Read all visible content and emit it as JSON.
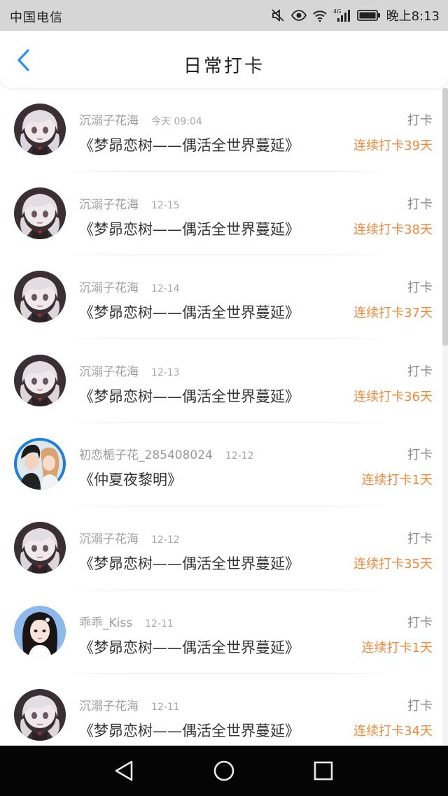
{
  "status_bar": {
    "carrier": "中国电信",
    "time": "晚上8:13",
    "network": "4G"
  },
  "header": {
    "title": "日常打卡",
    "back_icon": "chevron-left-icon",
    "accent_color": "#2f8ff0"
  },
  "entries": [
    {
      "user": "沉溺子花海",
      "time": "今天 09:04",
      "book": "《梦昴恋树——偶活全世界蔓延》",
      "type": "打卡",
      "streak": "连续打卡39天",
      "avatar": "anime"
    },
    {
      "user": "沉溺子花海",
      "time": "12-15",
      "book": "《梦昴恋树——偶活全世界蔓延》",
      "type": "打卡",
      "streak": "连续打卡38天",
      "avatar": "anime"
    },
    {
      "user": "沉溺子花海",
      "time": "12-14",
      "book": "《梦昴恋树——偶活全世界蔓延》",
      "type": "打卡",
      "streak": "连续打卡37天",
      "avatar": "anime"
    },
    {
      "user": "沉溺子花海",
      "time": "12-13",
      "book": "《梦昴恋树——偶活全世界蔓延》",
      "type": "打卡",
      "streak": "连续打卡36天",
      "avatar": "anime"
    },
    {
      "user": "初恋栀子花_285408024",
      "time": "12-12",
      "book": "《仲夏夜黎明》",
      "type": "打卡",
      "streak": "连续打卡1天",
      "avatar": "couple"
    },
    {
      "user": "沉溺子花海",
      "time": "12-12",
      "book": "《梦昴恋树——偶活全世界蔓延》",
      "type": "打卡",
      "streak": "连续打卡35天",
      "avatar": "anime"
    },
    {
      "user": "乖乖_Kiss",
      "time": "12-11",
      "book": "《梦昴恋树——偶活全世界蔓延》",
      "type": "打卡",
      "streak": "连续打卡1天",
      "avatar": "girl"
    },
    {
      "user": "沉溺子花海",
      "time": "12-11",
      "book": "《梦昴恋树——偶活全世界蔓延》",
      "type": "打卡",
      "streak": "连续打卡34天",
      "avatar": "anime"
    }
  ],
  "colors": {
    "streak": "#f0883a",
    "name": "#9a9a9a",
    "title": "#333333"
  },
  "system_nav": {
    "back_icon": "triangle-back-icon",
    "home_icon": "circle-home-icon",
    "recents_icon": "square-recents-icon"
  }
}
